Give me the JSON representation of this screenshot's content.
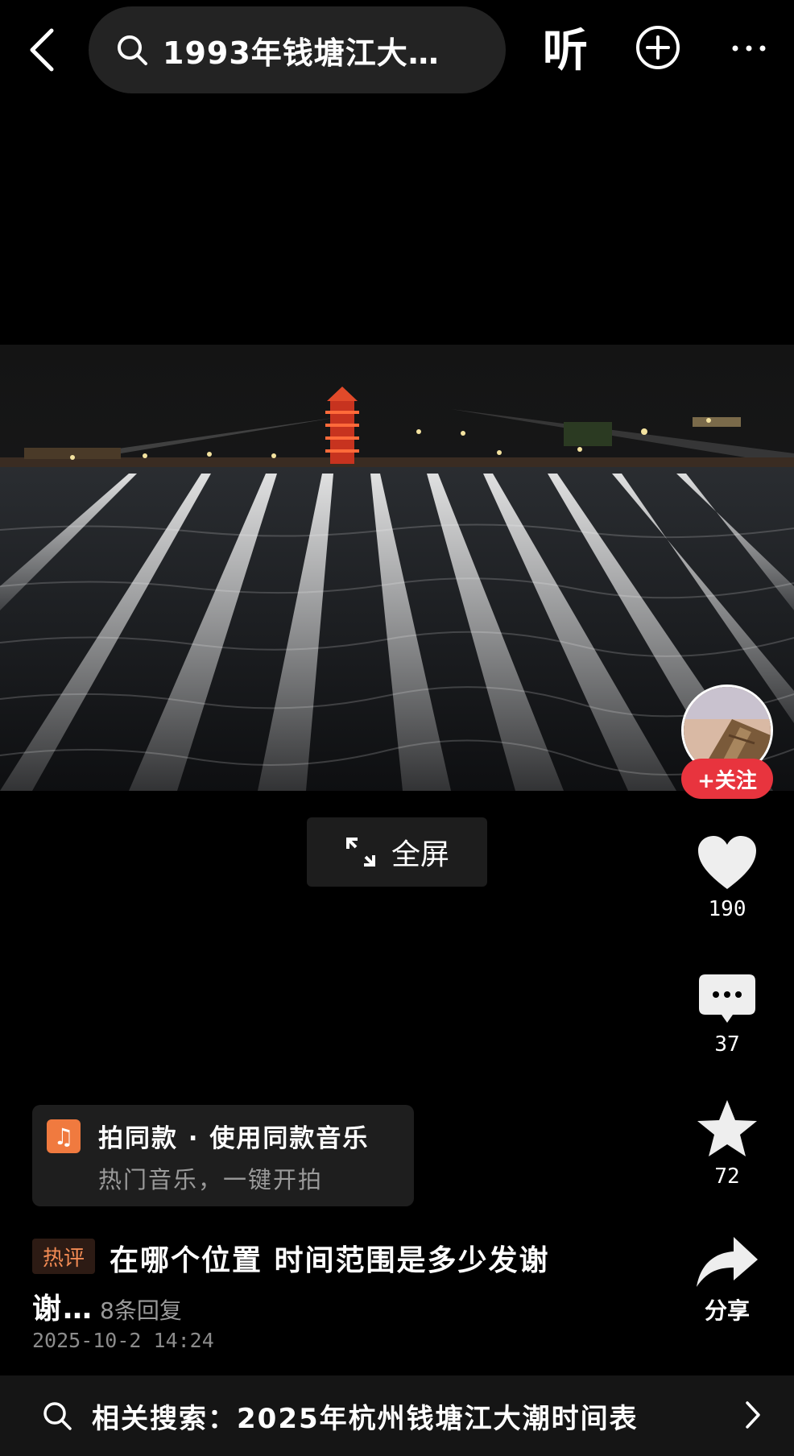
{
  "header": {
    "search_query": "1993年钱塘江大…",
    "listen_label": "听"
  },
  "video": {
    "fullscreen_label": "全屏"
  },
  "rail": {
    "follow_label": "+关注",
    "likes": "190",
    "comments": "37",
    "favorites": "72",
    "share_label": "分享"
  },
  "music": {
    "title": "拍同款 · 使用同款音乐",
    "subtitle": "热门音乐，一键开拍"
  },
  "comment": {
    "tag": "热评",
    "line1": "在哪个位置 时间范围是多少发谢",
    "line2": "谢…",
    "replies": "8条回复",
    "date": "2025-10-2 14:24"
  },
  "related": {
    "text": "相关搜索：2025年杭州钱塘江大潮时间表"
  },
  "colors": {
    "background": "#000000",
    "follow_red": "#e8343e",
    "hot_tag_orange": "#f28b54",
    "music_icon_orange": "#f07a3f"
  },
  "icons": [
    "back-icon",
    "search-icon",
    "add-circle-icon",
    "more-icon",
    "expand-icon",
    "heart-icon",
    "comment-icon",
    "star-icon",
    "share-icon",
    "music-note-icon",
    "chevron-right-icon"
  ]
}
